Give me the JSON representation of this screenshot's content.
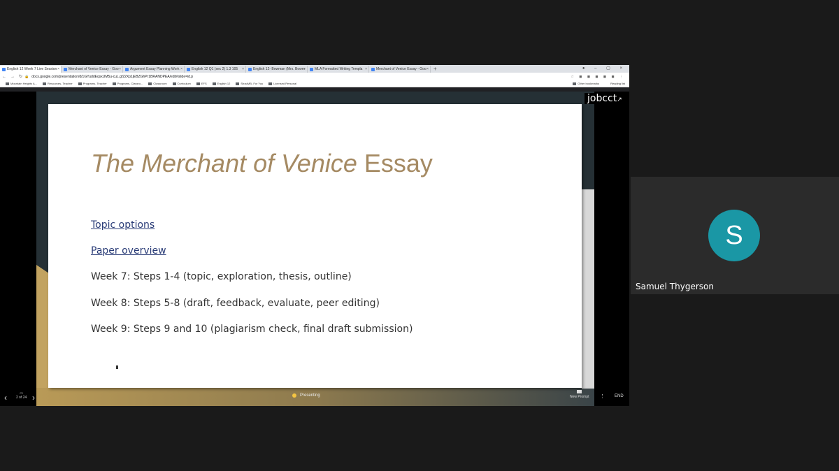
{
  "browser": {
    "tabs": [
      {
        "title": "English 12 Week 7 Live Session",
        "active": true
      },
      {
        "title": "Merchant of Venice Essay - Goo",
        "active": false
      },
      {
        "title": "Argument Essay Planning Work",
        "active": false
      },
      {
        "title": "English 12 Q1 (sec 2) 1.3 105",
        "active": false
      },
      {
        "title": "English 12- Bowman (Mrs. Bowm",
        "active": false
      },
      {
        "title": "MLA Formatted Writing Templa",
        "active": false
      },
      {
        "title": "Merchant of Venice Essay - Goo",
        "active": false
      }
    ],
    "new_tab": "+",
    "url": "docs.google.com/presentation/d/1GYuddEqsxUM5u-cuL.gf22Xp1jEBZGhPr1BRANDPEA/edit#slide=id.p",
    "bookmarks": [
      "Mountain Heights A...",
      "Resources- Teacher",
      "Programs- Teacher",
      "Programs- Classro...",
      "Classroom",
      "Curriculum",
      "EFS",
      "English 12",
      "StrauMB- For You",
      "Licensed Personal"
    ],
    "bookmarks_right": [
      "Other bookmarks",
      "Reading list"
    ]
  },
  "slide": {
    "title_italic": "The Merchant of Venice",
    "title_rest": " Essay",
    "link1": "Topic options",
    "link2": "Paper overview",
    "week7": "Week 7: Steps 1-4 (topic, exploration, thesis, outline)",
    "week8": "Week 8: Steps 5-8 (draft, feedback, evaluate, peer editing)",
    "week9": "Week 9: Steps 9 and 10 (plagiarism check, final draft submission)"
  },
  "controls": {
    "page": "2 of 24",
    "presenting": "Presenting",
    "new_prompt": "New Prompt",
    "end": "END"
  },
  "watermark": "jobcct",
  "participant": {
    "initial": "S",
    "name": "Samuel Thygerson",
    "avatar_color": "#1a97a5"
  }
}
